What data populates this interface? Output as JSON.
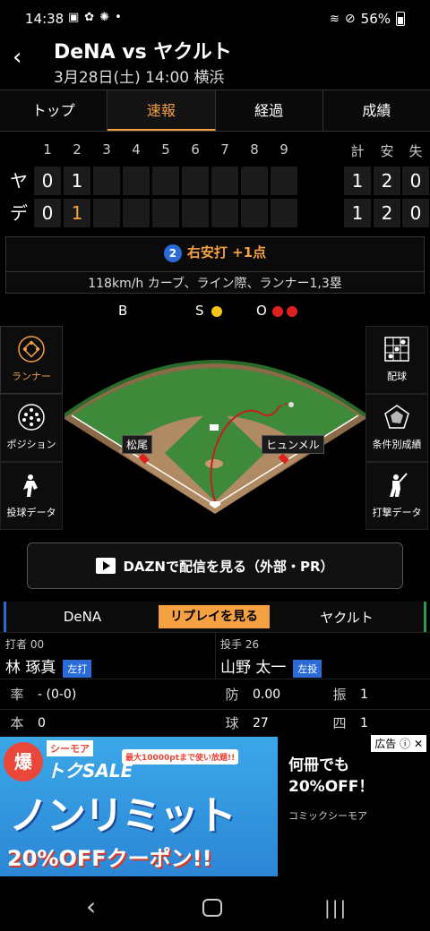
{
  "status": {
    "time": "14:38",
    "battery": "56%",
    "dot": "•"
  },
  "header": {
    "title": "DeNA vs ヤクルト",
    "subtitle": "3月28日(土) 14:00 横浜"
  },
  "tabs": [
    {
      "label": "トップ",
      "active": false
    },
    {
      "label": "速報",
      "active": true
    },
    {
      "label": "経過",
      "active": false
    },
    {
      "label": "成績",
      "active": false
    }
  ],
  "scoreboard": {
    "innings": [
      "1",
      "2",
      "3",
      "4",
      "5",
      "6",
      "7",
      "8",
      "9"
    ],
    "total_headers": [
      "計",
      "安",
      "失"
    ],
    "teams": [
      {
        "label": "ヤ",
        "scores": [
          "0",
          "1",
          "",
          "",
          "",
          "",
          "",
          "",
          ""
        ],
        "totals": [
          "1",
          "2",
          "0"
        ]
      },
      {
        "label": "デ",
        "scores": [
          "0",
          "1",
          "",
          "",
          "",
          "",
          "",
          "",
          ""
        ],
        "totals": [
          "1",
          "2",
          "0"
        ]
      }
    ]
  },
  "play": {
    "badge": "2",
    "headline": "右安打 +1点",
    "detail": "118km/h カーブ、ライン際、ランナー1,3塁"
  },
  "count": {
    "b_label": "B",
    "s_label": "S",
    "o_label": "O",
    "balls": 0,
    "strikes": 1,
    "outs": 2
  },
  "left_menu": [
    {
      "label": "ランナー",
      "icon": "runner-diamond-icon",
      "active": true
    },
    {
      "label": "ポジション",
      "icon": "position-dots-icon",
      "active": false
    },
    {
      "label": "投球データ",
      "icon": "pitcher-icon",
      "active": false
    }
  ],
  "right_menu": [
    {
      "label": "配球",
      "icon": "pitch-grid-icon"
    },
    {
      "label": "条件別成績",
      "icon": "radar-chart-icon"
    },
    {
      "label": "打撃データ",
      "icon": "batter-icon"
    }
  ],
  "field": {
    "runner_labels": [
      "松尾",
      "ヒュンメル"
    ]
  },
  "dazn": {
    "label": "DAZNで配信を見る（外部・PR）"
  },
  "team_switch": {
    "left": "DeNA",
    "middle": "リプレイを見る",
    "right": "ヤクルト"
  },
  "batter": {
    "label": "打者 00",
    "name": "林 琢真",
    "tag": "左打",
    "stats": [
      {
        "key": "率",
        "value": "- (0-0)"
      },
      {
        "key": "本",
        "value": "0"
      }
    ]
  },
  "pitcher": {
    "label": "投手 26",
    "name": "山野 太一",
    "tag": "左投",
    "stats": [
      {
        "key": "防",
        "value": "0.00"
      },
      {
        "key": "球",
        "value": "27"
      }
    ],
    "stats_right": [
      {
        "key": "振",
        "value": "1"
      },
      {
        "key": "四",
        "value": "1"
      }
    ]
  },
  "ad": {
    "badge": "広告",
    "img_top": "シーモア",
    "img_sale": "トクSALE",
    "img_points": "最大10000ptまで使い放題!!",
    "img_main": "ノンリミット",
    "img_coupon": "20%OFFクーポン!!",
    "img_explode": "爆",
    "headline_1": "何冊でも",
    "headline_2": "20%OFF！",
    "sub": "コミックシーモア"
  },
  "colors": {
    "accent": "#f5a142",
    "blue": "#2a6bd6",
    "strike": "#f5c518",
    "out": "#e02020"
  }
}
